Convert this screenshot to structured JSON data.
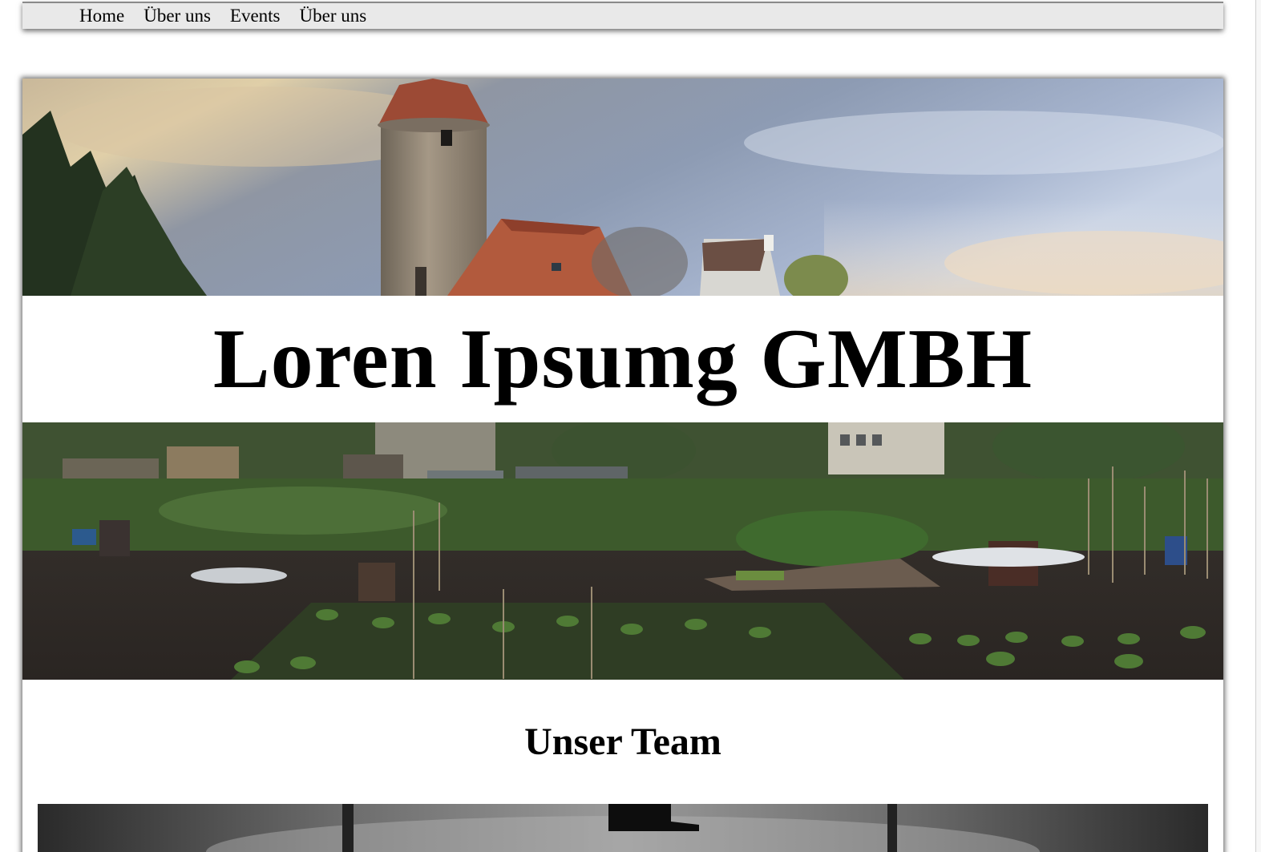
{
  "nav": {
    "items": [
      {
        "label": "Home"
      },
      {
        "label": "Über uns"
      },
      {
        "label": "Events"
      },
      {
        "label": "Über uns"
      }
    ]
  },
  "header": {
    "title": "Loren Ipsumg GMBH"
  },
  "team_section": {
    "heading": "Unser Team"
  },
  "colors": {
    "nav_background": "#e9e9e9",
    "page_background": "#ffffff",
    "text": "#000000"
  }
}
